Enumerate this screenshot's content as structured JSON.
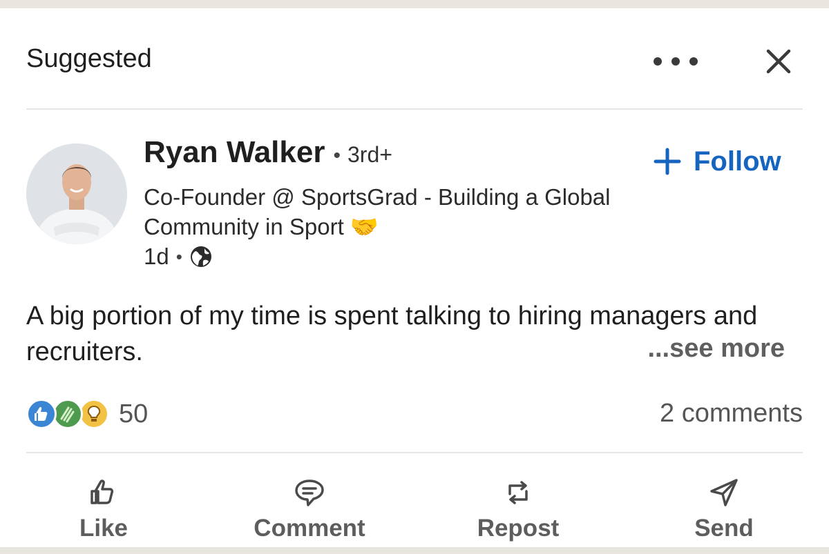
{
  "header": {
    "label": "Suggested",
    "more_icon": "more-horizontal-icon",
    "close_icon": "close-icon"
  },
  "author": {
    "name": "Ryan Walker",
    "degree": "3rd+",
    "headline": "Co-Founder @ SportsGrad - Building a Global Community in Sport 🤝",
    "time": "1d",
    "visibility_icon": "globe-icon",
    "follow_label": "Follow"
  },
  "post": {
    "text": "A big portion of my time is spent talking to hiring managers and recruiters.",
    "see_more": "...see more"
  },
  "social": {
    "reaction_count": "50",
    "reactions": [
      "like",
      "celebrate",
      "insightful"
    ],
    "comments": "2 comments"
  },
  "actions": {
    "like": "Like",
    "comment": "Comment",
    "repost": "Repost",
    "send": "Send"
  },
  "colors": {
    "accent": "#1565c0",
    "background": "#e9e6df",
    "card": "#ffffff"
  }
}
